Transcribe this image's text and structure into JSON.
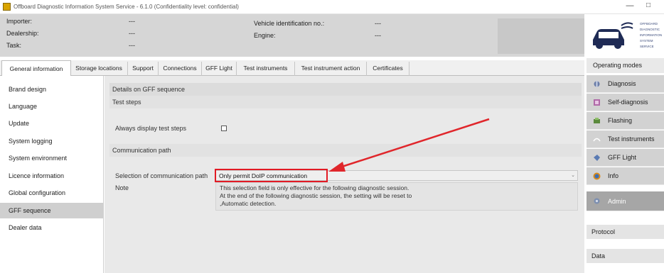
{
  "window": {
    "title": "Offboard Diagnostic Information System Service - 6.1.0 (Confidentiality level: confidential)",
    "minimize": "—",
    "maximize": "□"
  },
  "header": {
    "importer_label": "Importer:",
    "importer_value": "---",
    "dealership_label": "Dealership:",
    "dealership_value": "---",
    "task_label": "Task:",
    "task_value": "---",
    "vin_label": "Vehicle identification no.:",
    "vin_value": "---",
    "engine_label": "Engine:",
    "engine_value": "---"
  },
  "logo": {
    "lines": [
      "OFFBOARD",
      "DIAGNOSTIC",
      "INFORMATION",
      "SYSTEM",
      "SERVICE"
    ]
  },
  "tabs": [
    {
      "label": "General information",
      "active": true
    },
    {
      "label": "Storage locations",
      "active": false
    },
    {
      "label": "Support",
      "active": false
    },
    {
      "label": "Connections",
      "active": false
    },
    {
      "label": "GFF Light",
      "active": false
    },
    {
      "label": "Test instruments",
      "active": false
    },
    {
      "label": "Test instrument action",
      "active": false
    },
    {
      "label": "Certificates",
      "active": false
    }
  ],
  "sidebar": {
    "items": [
      {
        "label": "Brand design",
        "selected": false
      },
      {
        "label": "Language",
        "selected": false
      },
      {
        "label": "Update",
        "selected": false
      },
      {
        "label": "System logging",
        "selected": false
      },
      {
        "label": "System environment",
        "selected": false
      },
      {
        "label": "Licence information",
        "selected": false
      },
      {
        "label": "Global configuration",
        "selected": false
      },
      {
        "label": "GFF sequence",
        "selected": true
      },
      {
        "label": "Dealer data",
        "selected": false
      }
    ]
  },
  "main": {
    "details_header": "Details on GFF sequence",
    "test_steps_header": "Test steps",
    "always_display_label": "Always display test steps",
    "always_display_checked": false,
    "comm_path_header": "Communication path",
    "selection_label": "Selection of communication path",
    "selection_value": "Only permit DoIP communication",
    "note_label": "Note",
    "note_lines": [
      "This selection field is only effective for the following diagnostic session.",
      "At the end of the following diagnostic session, the setting will be reset to",
      ",Automatic detection."
    ]
  },
  "right_panel": {
    "operating_modes_label": "Operating modes",
    "modes": [
      {
        "label": "Diagnosis",
        "icon": "diagnosis-icon",
        "active": false
      },
      {
        "label": "Self-diagnosis",
        "icon": "self-diagnosis-icon",
        "active": false
      },
      {
        "label": "Flashing",
        "icon": "flashing-icon",
        "active": false
      },
      {
        "label": "Test instruments",
        "icon": "test-instruments-icon",
        "active": false
      },
      {
        "label": "GFF Light",
        "icon": "gff-light-icon",
        "active": false
      },
      {
        "label": "Info",
        "icon": "info-icon",
        "active": false
      },
      {
        "label": "Admin",
        "icon": "admin-icon",
        "active": true
      }
    ],
    "protocol_label": "Protocol",
    "data_label": "Data"
  },
  "colors": {
    "highlight_red": "#e21b25",
    "arrow_red": "#e0262b",
    "active_mode_bg": "#a6a6a6"
  }
}
